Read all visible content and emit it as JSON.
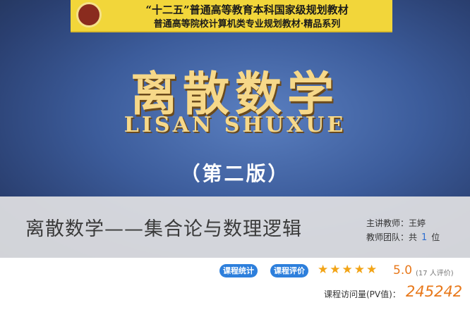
{
  "cover": {
    "banner_line1": "“十二五”普通高等教育本科国家级规划教材",
    "banner_line2": "普通高等院校计算机类专业规划教材·精品系列",
    "title": "离散数学",
    "pinyin": "LISAN SHUXUE",
    "edition": "（第二版）"
  },
  "course": {
    "title": "离散数学——集合论与数理逻辑",
    "teacher_label": "主讲教师：王婷",
    "team_label_prefix": "教师团队：共",
    "team_count": "1",
    "team_label_suffix": "位"
  },
  "actions": {
    "stats_label": "课程统计",
    "review_label": "课程评价"
  },
  "rating": {
    "stars": "★★★★★",
    "value": "5.0",
    "count_text": "(17 人评价)"
  },
  "pv": {
    "label": "课程访问量(PV值)：",
    "value": "245242"
  },
  "colors": {
    "accent": "#2d7fdc",
    "rating": "#e8781a",
    "star": "#f2a416"
  }
}
